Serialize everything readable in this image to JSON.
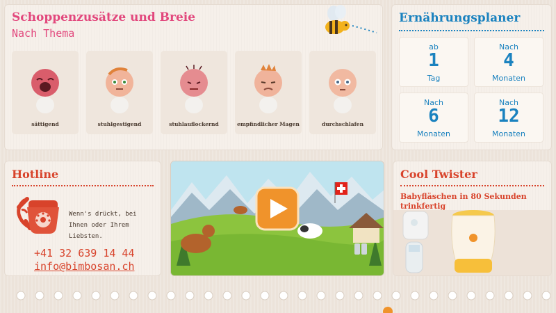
{
  "themes": {
    "title": "Schoppenzusätze und Breie",
    "subtitle": "Nach Thema",
    "items": [
      {
        "label": "sättigend"
      },
      {
        "label": "stuhlgestigend"
      },
      {
        "label": "stuhlauflockernd"
      },
      {
        "label": "empfindlicher Magen"
      },
      {
        "label": "durchschlafen"
      }
    ]
  },
  "planer": {
    "title": "Ernährungsplaner",
    "cards": [
      {
        "top": "ab",
        "num": "1",
        "bottom": "Tag"
      },
      {
        "top": "Nach",
        "num": "4",
        "bottom": "Monaten"
      },
      {
        "top": "Nach",
        "num": "6",
        "bottom": "Monaten"
      },
      {
        "top": "Nach",
        "num": "12",
        "bottom": "Monaten"
      }
    ]
  },
  "hotline": {
    "title": "Hotline",
    "text": "Wenn's drückt, bei Ihnen oder Ihrem Liebsten.",
    "phone": "+41 32 639 14 44",
    "email": "info@bimbosan.ch",
    "icon": "telephone-icon"
  },
  "video": {
    "icon": "play-icon"
  },
  "twister": {
    "title": "Cool Twister",
    "subtitle": "Babyfläschen in 80 Sekunden trinkfertig"
  },
  "colors": {
    "pink": "#e2487d",
    "blue": "#1a82bf",
    "red": "#d8432b",
    "orange": "#f0932b"
  }
}
